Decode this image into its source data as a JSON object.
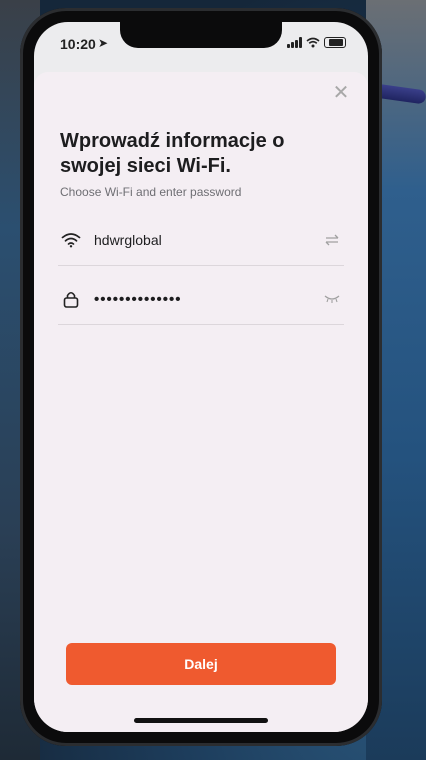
{
  "status_bar": {
    "time": "10:20",
    "location_icon": "location-arrow-icon",
    "battery_level_percent": 80
  },
  "sheet": {
    "close_icon": "close-icon",
    "title": "Wprowadź informacje o swojej sieci Wi-Fi.",
    "subtitle": "Choose Wi-Fi and enter password"
  },
  "wifi_field": {
    "icon": "wifi-icon",
    "value": "hdwrglobal",
    "action_icon": "switch-arrows-icon"
  },
  "password_field": {
    "icon": "lock-icon",
    "value": "••••••••••••••",
    "action_icon": "eye-closed-icon"
  },
  "next_button": {
    "label": "Dalej"
  },
  "colors": {
    "accent": "#ef5a2f",
    "sheet_bg": "#f4eef3",
    "text_primary": "#1d1d1f",
    "text_secondary": "#6e6e73"
  }
}
